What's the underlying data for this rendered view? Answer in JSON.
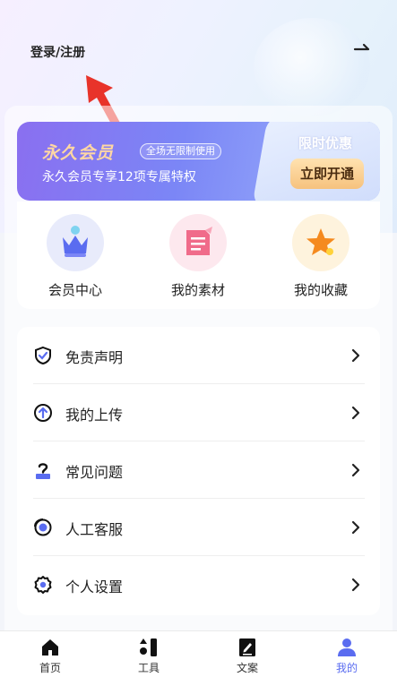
{
  "header": {
    "login_text": "登录/注册"
  },
  "vip": {
    "title": "永久会员",
    "tag": "全场无限制使用",
    "subtitle": "永久会员专享12项专属特权",
    "limited": "限时优惠",
    "button": "立即开通"
  },
  "quick": [
    {
      "label": "会员中心",
      "icon": "crown-icon"
    },
    {
      "label": "我的素材",
      "icon": "document-icon"
    },
    {
      "label": "我的收藏",
      "icon": "star-icon"
    }
  ],
  "menu": [
    {
      "label": "免责声明",
      "icon": "shield-check-icon"
    },
    {
      "label": "我的上传",
      "icon": "upload-icon"
    },
    {
      "label": "常见问题",
      "icon": "question-icon"
    },
    {
      "label": "人工客服",
      "icon": "customer-service-icon"
    },
    {
      "label": "个人设置",
      "icon": "gear-icon"
    }
  ],
  "tabs": [
    {
      "label": "首页",
      "icon": "home-icon"
    },
    {
      "label": "工具",
      "icon": "tools-icon"
    },
    {
      "label": "文案",
      "icon": "edit-note-icon"
    },
    {
      "label": "我的",
      "icon": "person-icon",
      "active": true
    }
  ],
  "colors": {
    "accent": "#5a6cf0",
    "vip_gold": "#ffd7a3",
    "annotation_red": "#e8332a"
  }
}
